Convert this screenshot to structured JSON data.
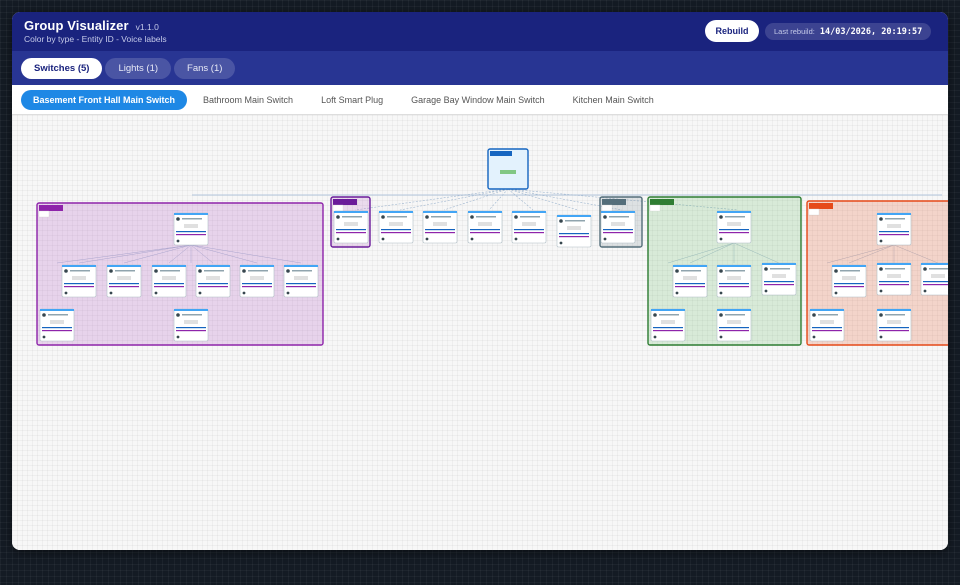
{
  "header": {
    "title": "Group Visualizer",
    "version": "v1.1.0",
    "subtitle": "Color by type - Entity ID - Voice labels",
    "rebuild_label": "Rebuild",
    "last_rebuild_label": "Last rebuild:",
    "last_rebuild_value": "14/03/2026, 20:19:57"
  },
  "type_tabs": [
    {
      "label": "Switches (5)",
      "active": true
    },
    {
      "label": "Lights (1)",
      "active": false
    },
    {
      "label": "Fans (1)",
      "active": false
    }
  ],
  "entity_tabs": [
    {
      "label": "Basement Front Hall Main Switch",
      "active": true
    },
    {
      "label": "Bathroom Main Switch",
      "active": false
    },
    {
      "label": "Loft Smart Plug",
      "active": false
    },
    {
      "label": "Garage Bay Window Main Switch",
      "active": false
    },
    {
      "label": "Kitchen Main Switch",
      "active": false
    }
  ],
  "colors": {
    "header_bg": "#1a237e",
    "type_bar_bg": "#283593",
    "active_entity": "#1e88e5",
    "group_purple": "#8e24aa",
    "group_dark_purple": "#6a1b9a",
    "group_grey": "#546e7a",
    "group_green": "#2e7d32",
    "group_orange": "#e64a19",
    "root_blue": "#1565c0",
    "node_bar": "#42a5f5"
  }
}
